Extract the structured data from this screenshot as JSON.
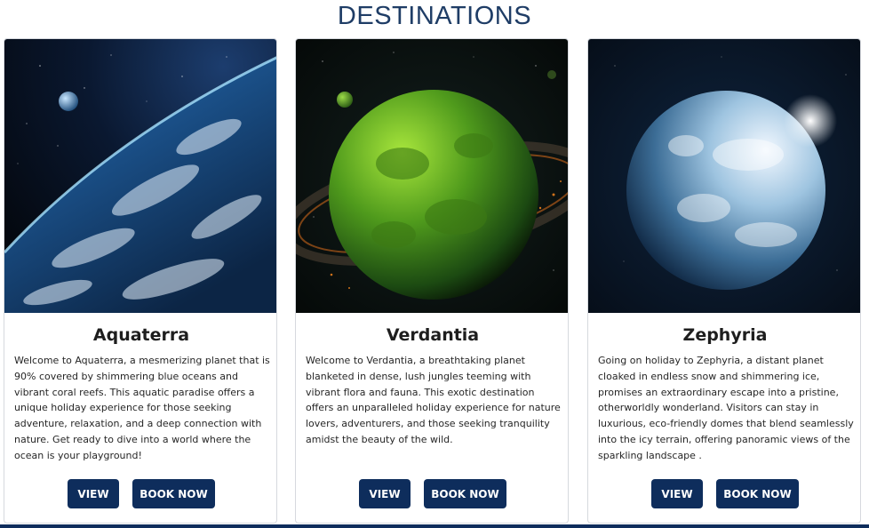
{
  "page": {
    "title": "DESTINATIONS"
  },
  "destinations": [
    {
      "name": "Aquaterra",
      "description": "Welcome to Aquaterra, a mesmerizing planet that is 90% covered by shimmering blue oceans and vibrant coral reefs. This aquatic paradise offers a unique holiday experience for those seeking adventure, relaxation, and a deep connection with nature. Get ready to dive into a world where the ocean is your playground!",
      "view_label": "VIEW",
      "book_label": "BOOK NOW",
      "image": "blue ocean planet from orbit"
    },
    {
      "name": "Verdantia",
      "description": "Welcome to Verdantia, a breathtaking planet blanketed in dense, lush jungles teeming with vibrant flora and fauna. This exotic destination offers an unparalleled holiday experience for nature lovers, adventurers, and those seeking tranquility amidst the beauty of the wild.",
      "view_label": "VIEW",
      "book_label": "BOOK NOW",
      "image": "green jungle planet"
    },
    {
      "name": "Zephyria",
      "description": "Going on holiday to Zephyria, a distant planet cloaked in endless snow and shimmering ice, promises an extraordinary escape into a pristine, otherworldly wonderland. Visitors can stay in luxurious, eco-friendly domes that blend seamlessly into the icy terrain, offering panoramic views of the sparkling landscape .",
      "view_label": "VIEW",
      "book_label": "BOOK NOW",
      "image": "ice planet"
    }
  ],
  "colors": {
    "primary": "#0e2d5c",
    "title": "#1f3d66"
  }
}
